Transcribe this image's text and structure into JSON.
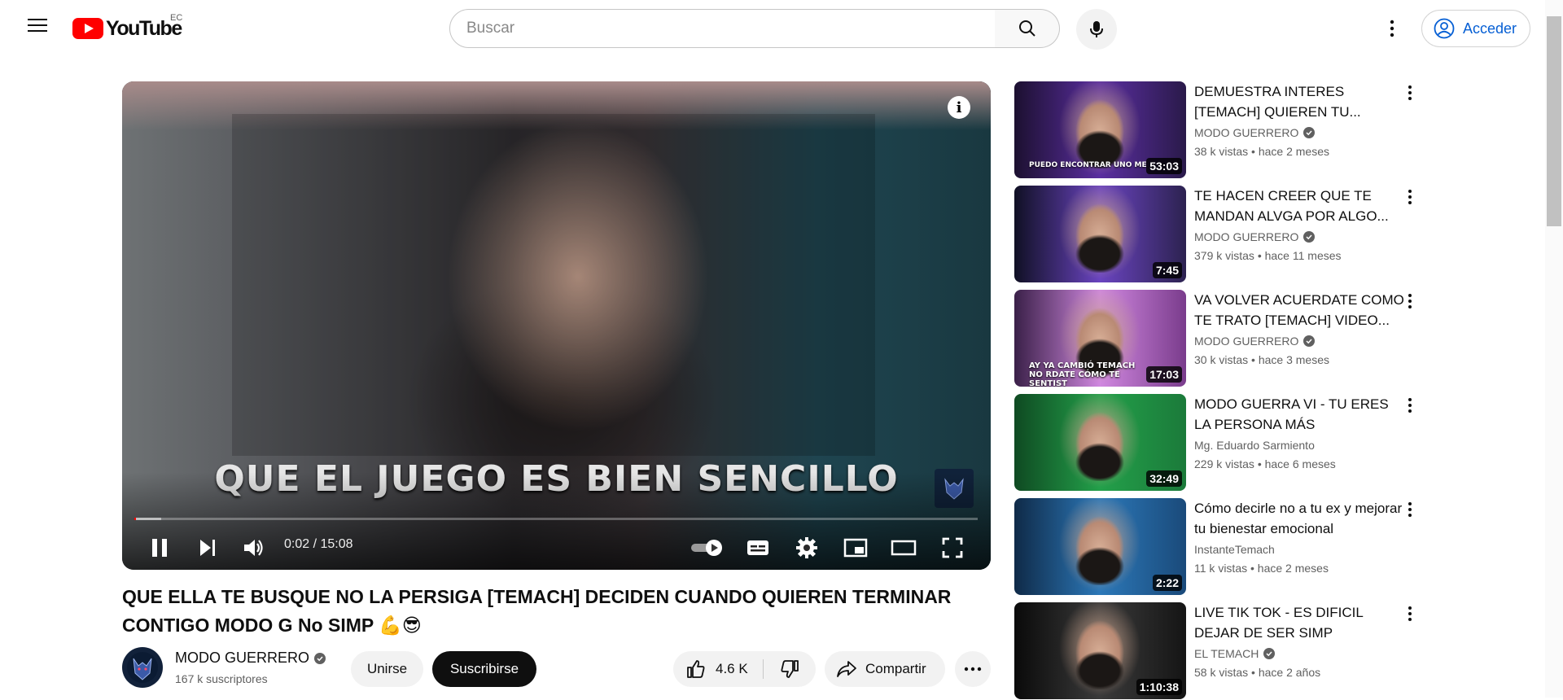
{
  "header": {
    "logo_text": "YouTube",
    "region": "EC",
    "search_placeholder": "Buscar",
    "signin_label": "Acceder"
  },
  "player": {
    "caption": "QUE EL JUEGO ES BIEN SENCILLO",
    "time_display": "0:02 / 15:08",
    "progress_fraction": 0.0022,
    "buffer_fraction": 0.032
  },
  "video": {
    "title": "QUE ELLA TE BUSQUE NO LA PERSIGA [TEMACH] DECIDEN CUANDO QUIEREN TERMINAR CONTIGO MODO G No SIMP 💪😎",
    "channel_name": "MODO GUERRERO",
    "subscribers": "167 k suscriptores",
    "join_label": "Unirse",
    "subscribe_label": "Suscribirse",
    "likes": "4.6 K",
    "share_label": "Compartir"
  },
  "recommendations": [
    {
      "title": "DEMUESTRA INTERES [TEMACH] QUIEREN TU...",
      "channel": "MODO GUERRERO",
      "verified": true,
      "views": "38 k vistas",
      "age": "hace 2 meses",
      "duration": "53:03",
      "thumb_colors": [
        "#2a1a4a",
        "#5a2ea0",
        "#1c1030"
      ],
      "thumb_caption": "PUEDO ENCONTRAR UNO ME"
    },
    {
      "title": "TE HACEN CREER QUE TE MANDAN ALVGA POR ALGO...",
      "channel": "MODO GUERRERO",
      "verified": true,
      "views": "379 k vistas",
      "age": "hace 11 meses",
      "duration": "7:45",
      "thumb_colors": [
        "#2c2250",
        "#6a44c0",
        "#101024"
      ],
      "thumb_caption": ""
    },
    {
      "title": "VA VOLVER ACUERDATE COMO TE TRATO [TEMACH] VIDEO...",
      "channel": "MODO GUERRERO",
      "verified": true,
      "views": "30 k vistas",
      "age": "hace 3 meses",
      "duration": "17:03",
      "thumb_colors": [
        "#7a3c8c",
        "#d088e0",
        "#3a2048"
      ],
      "thumb_caption": "AY YA CAMBIÓ TEMACH NO RDATE CÓMO TE SENTIST"
    },
    {
      "title": "MODO GUERRA VI - TU ERES LA PERSONA MÁS IMPORTANTE",
      "channel": "Mg. Eduardo Sarmiento",
      "verified": false,
      "views": "229 k vistas",
      "age": "hace 6 meses",
      "duration": "32:49",
      "thumb_colors": [
        "#1b7a3a",
        "#23a04a",
        "#0f4a22"
      ],
      "thumb_caption": ""
    },
    {
      "title": "Cómo decirle no a tu ex y mejorar tu bienestar emocional",
      "channel": "InstanteTemach",
      "verified": false,
      "views": "11 k vistas",
      "age": "hace 2 meses",
      "duration": "2:22",
      "thumb_colors": [
        "#1a4a7a",
        "#2c78b8",
        "#0f2a48"
      ],
      "thumb_caption": ""
    },
    {
      "title": "LIVE TIK TOK - ES DIFICIL DEJAR DE SER SIMP",
      "channel": "EL TEMACH",
      "verified": true,
      "views": "58 k vistas",
      "age": "hace 2 años",
      "duration": "1:10:38",
      "thumb_colors": [
        "#151515",
        "#3a3a3a",
        "#0a0a0a"
      ],
      "thumb_caption": ""
    }
  ]
}
